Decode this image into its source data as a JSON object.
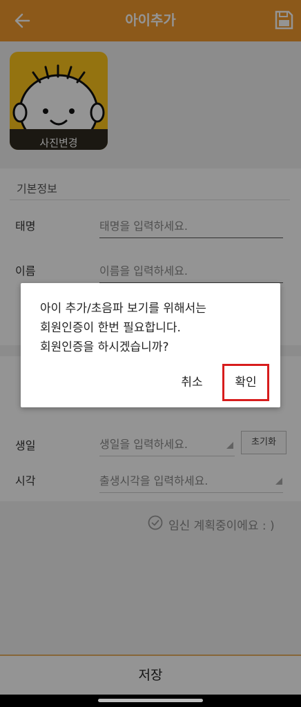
{
  "header": {
    "title": "아이추가",
    "back_icon": "arrow-left-icon",
    "save_icon": "floppy-disk-icon"
  },
  "photo": {
    "label": "사진변경"
  },
  "form": {
    "section_title": "기본정보",
    "rows": [
      {
        "label": "태명",
        "placeholder": "태명을 입력하세요."
      },
      {
        "label": "이름",
        "placeholder": "이름을 입력하세요."
      }
    ],
    "birth": {
      "label": "생일",
      "placeholder": "생일을 입력하세요.",
      "reset_label": "초기화"
    },
    "time": {
      "label": "시각",
      "placeholder": "출생시각을 입력하세요."
    },
    "pregnant_label": "임신 계획중이에요 : )"
  },
  "footer": {
    "save_label": "저장"
  },
  "dialog": {
    "message_lines": [
      "아이 추가/초음파 보기를 위해서는",
      "회원인증이 한번 필요합니다.",
      "회원인증을 하시겠습니까?"
    ],
    "cancel_label": "취소",
    "confirm_label": "확인"
  },
  "colors": {
    "header": "#f29a2e",
    "photo_bg": "#ffc61c",
    "highlight": "#d71c1c"
  }
}
